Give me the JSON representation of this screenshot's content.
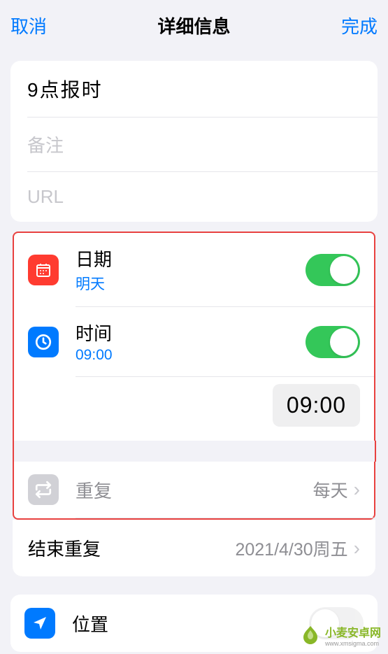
{
  "header": {
    "cancel": "取消",
    "title": "详细信息",
    "done": "完成"
  },
  "fields": {
    "title_value": "9点报时",
    "notes_placeholder": "备注",
    "url_placeholder": "URL"
  },
  "date": {
    "label": "日期",
    "value": "明天",
    "enabled": true
  },
  "time": {
    "label": "时间",
    "value": "09:00",
    "display": "09:00",
    "enabled": true
  },
  "repeat": {
    "label": "重复",
    "value": "每天"
  },
  "end_repeat": {
    "label": "结束重复",
    "value": "2021/4/30周五"
  },
  "location": {
    "label": "位置",
    "enabled": false
  },
  "watermark": {
    "main": "小麦安卓网",
    "sub": "www.xmsigma.com"
  }
}
